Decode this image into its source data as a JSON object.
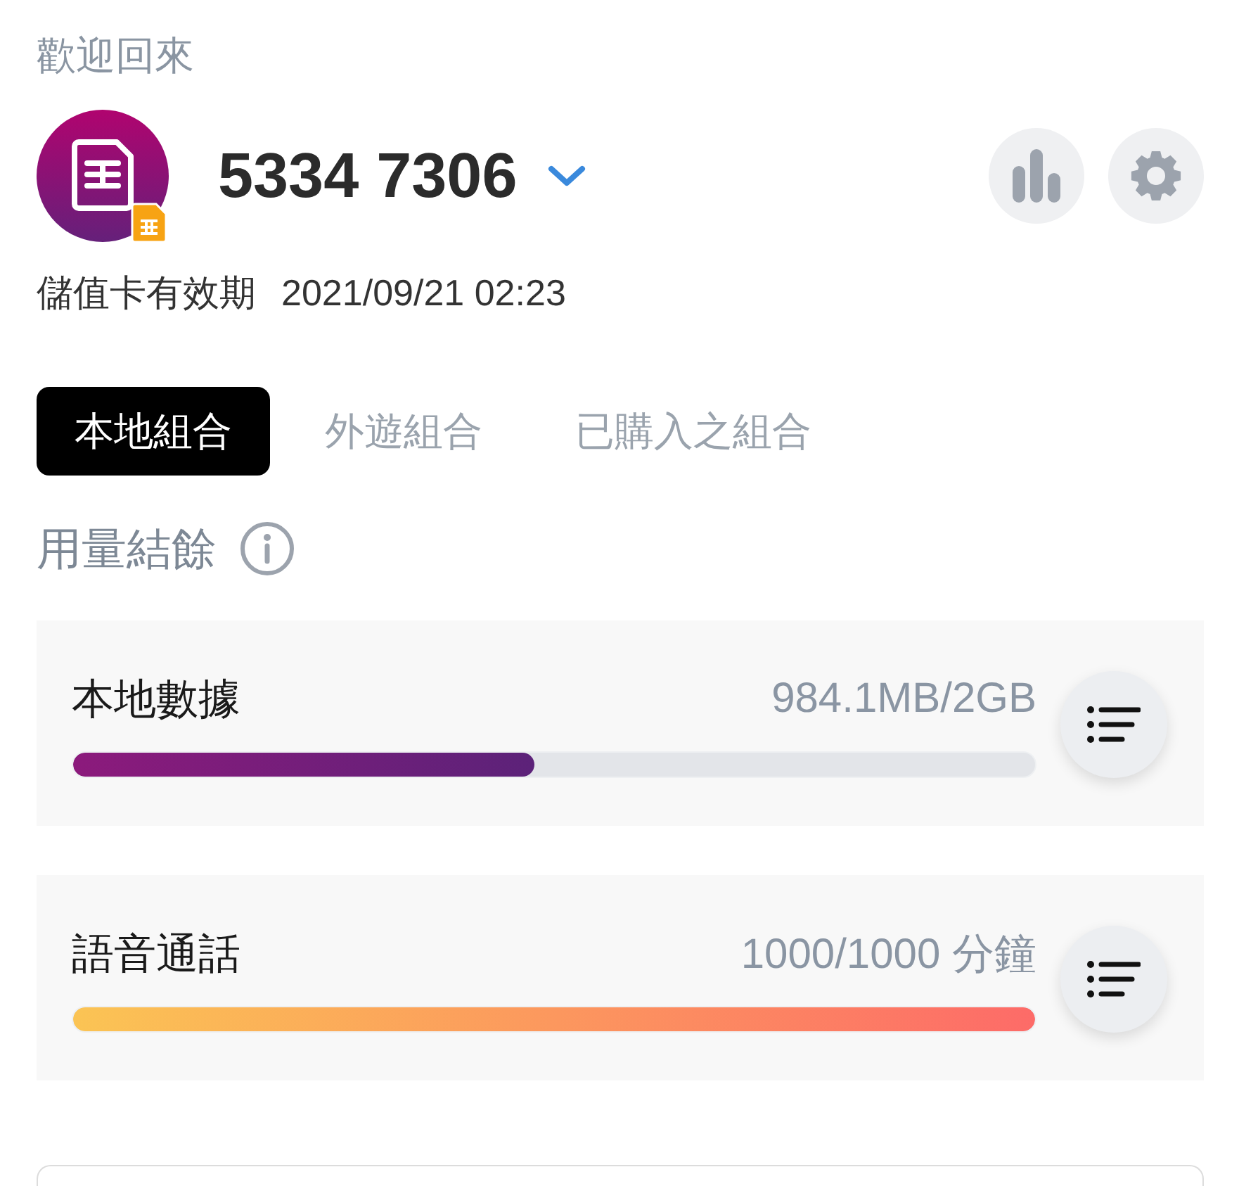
{
  "greeting": "歡迎回來",
  "account": {
    "number": "5334 7306"
  },
  "expiry": {
    "label": "儲值卡有效期",
    "value": "2021/09/21 02:23"
  },
  "tabs": [
    {
      "label": "本地組合",
      "selected": true
    },
    {
      "label": "外遊組合",
      "selected": false
    },
    {
      "label": "已購入之組合",
      "selected": false
    }
  ],
  "section": {
    "title": "用量結餘"
  },
  "usage": [
    {
      "kind": "data",
      "name": "本地數據",
      "reading": "984.1MB/2GB",
      "level": 0.48
    },
    {
      "kind": "voice",
      "name": "語音通話",
      "reading": "1000/1000 分鐘",
      "level": 1
    }
  ]
}
